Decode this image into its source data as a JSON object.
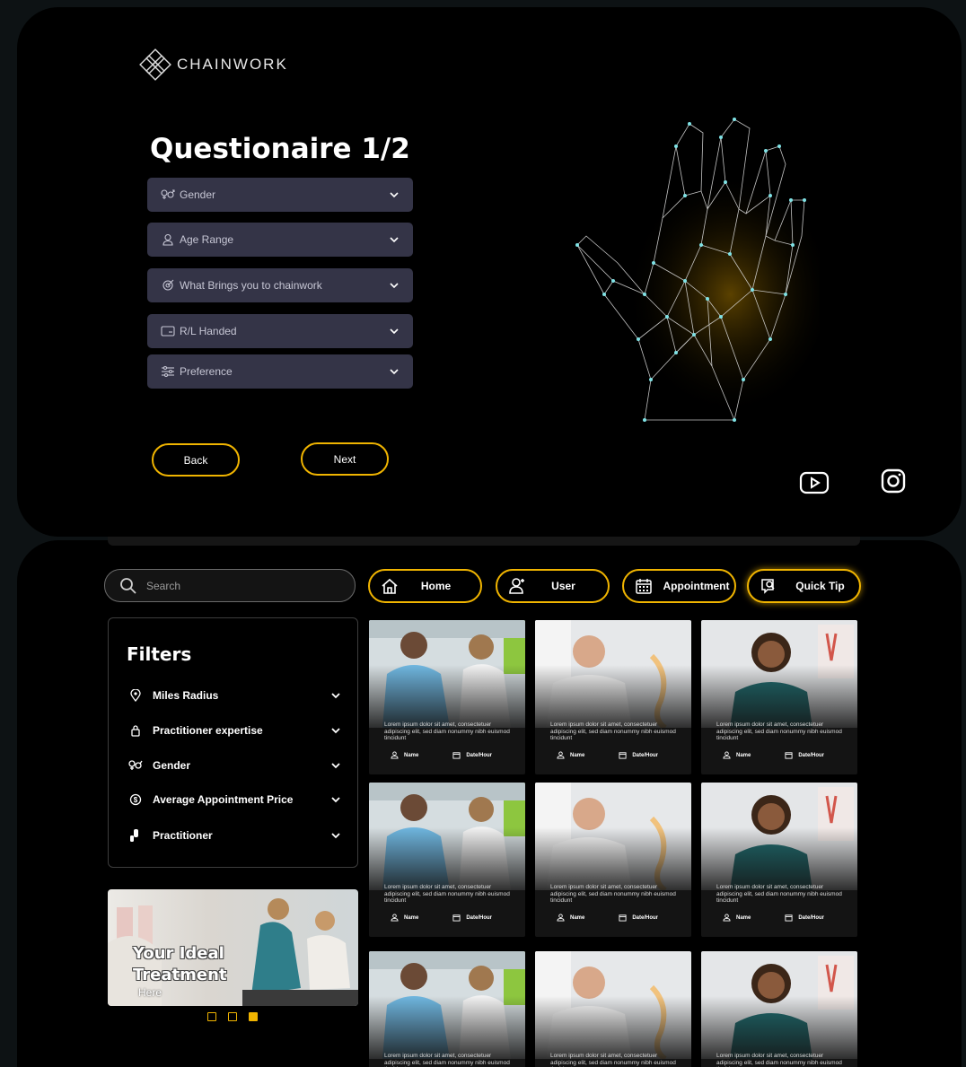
{
  "brand": {
    "name": "CHAINWORK"
  },
  "questionnaire": {
    "title": "Questionaire 1/2",
    "fields": [
      {
        "icon": "gender-icon",
        "label": "Gender"
      },
      {
        "icon": "user-icon",
        "label": "Age Range"
      },
      {
        "icon": "target-icon",
        "label": "What Brings you to chainwork"
      },
      {
        "icon": "card-icon",
        "label": "R/L Handed"
      },
      {
        "icon": "sliders-icon",
        "label": "Preference"
      }
    ],
    "back_label": "Back",
    "next_label": "Next"
  },
  "social": [
    "youtube-icon",
    "instagram-icon"
  ],
  "search": {
    "placeholder": "Search"
  },
  "nav": [
    {
      "icon": "home-icon",
      "label": "Home"
    },
    {
      "icon": "user-icon",
      "label": "User"
    },
    {
      "icon": "calendar-icon",
      "label": "Appointment"
    },
    {
      "icon": "tip-icon",
      "label": "Quick Tip"
    }
  ],
  "filters": {
    "title": "Filters",
    "items": [
      {
        "icon": "location-icon",
        "label": "Miles Radius"
      },
      {
        "icon": "lock-icon",
        "label": "Practitioner expertise"
      },
      {
        "icon": "gender-icon",
        "label": "Gender"
      },
      {
        "icon": "coin-icon",
        "label": "Average Appointment Price"
      },
      {
        "icon": "practitioner-icon",
        "label": "Practitioner"
      }
    ]
  },
  "promo": {
    "line1": "Your Ideal",
    "line2": "Treatment",
    "line3": "Here",
    "active_slide": 3,
    "slides": 3
  },
  "cards": {
    "description": "Lorem ipsum dolor sit amet, consectetuer adipiscing elit, sed diam nonummy nibh euismod tincidunt",
    "name_label": "Name",
    "date_label": "Date/Hour"
  },
  "colors": {
    "accent": "#f0b400",
    "field_bg": "#343447",
    "page_bg": "#0d1214"
  }
}
